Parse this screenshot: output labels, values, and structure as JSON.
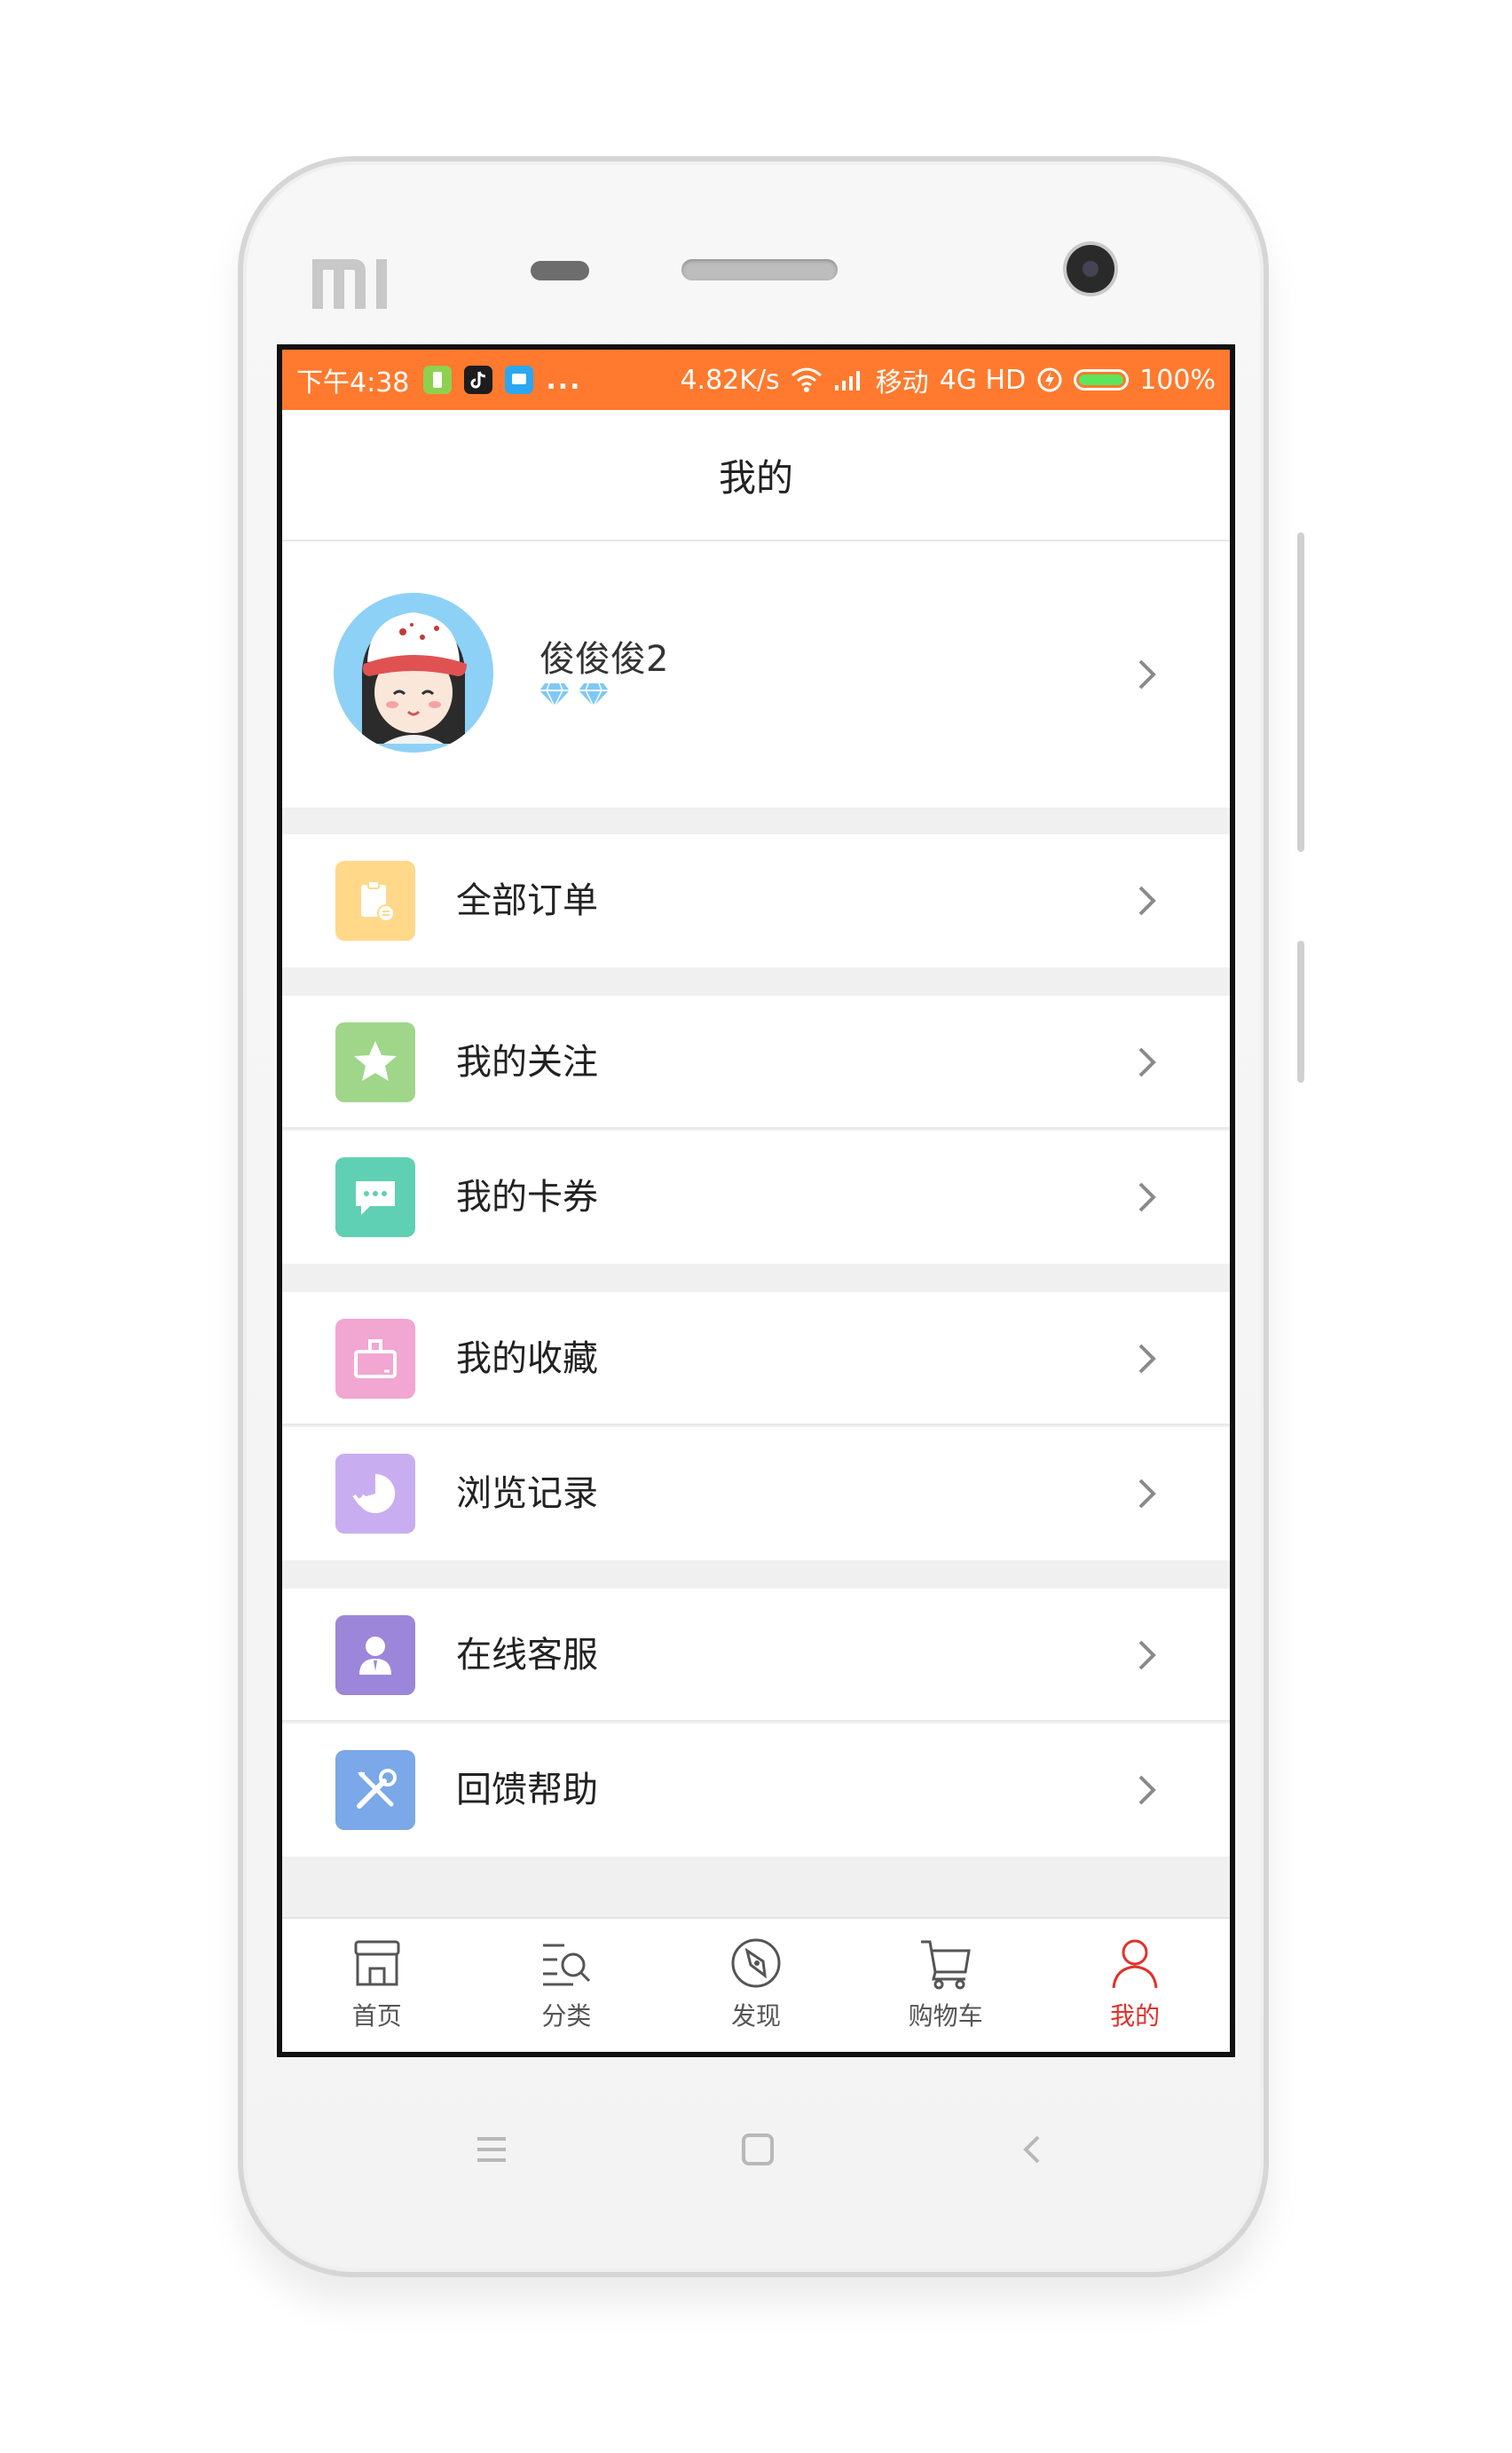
{
  "status_bar": {
    "time": "下午4:38",
    "dots": "...",
    "speed": "4.82K/s",
    "carrier": "移动",
    "network": "4G HD",
    "battery_text": "100%",
    "battery_level": 1.0,
    "icons": [
      "battery-app-icon",
      "tiktok-icon",
      "message-app-icon",
      "wifi-icon",
      "signal-icon",
      "charging-icon"
    ]
  },
  "header": {
    "title": "我的"
  },
  "profile": {
    "username": "俊俊俊2",
    "badge_icon": "diamond-icon",
    "badge_count": 2
  },
  "menu": [
    {
      "label": "全部订单",
      "icon": "clipboard-order-icon",
      "color": "#ffd88a"
    },
    {
      "label": "我的关注",
      "icon": "star-icon",
      "color": "#9fd68a"
    },
    {
      "label": "我的卡券",
      "icon": "chat-bubble-icon",
      "color": "#5fd0b3"
    },
    {
      "label": "我的收藏",
      "icon": "tv-collection-icon",
      "color": "#f2a6d2"
    },
    {
      "label": "浏览记录",
      "icon": "history-clock-icon",
      "color": "#c8aef0"
    },
    {
      "label": "在线客服",
      "icon": "service-person-icon",
      "color": "#9b86da"
    },
    {
      "label": "回馈帮助",
      "icon": "tools-icon",
      "color": "#7aa8e8"
    }
  ],
  "tabs": [
    {
      "label": "首页",
      "icon": "home-store-icon",
      "active": false
    },
    {
      "label": "分类",
      "icon": "category-search-icon",
      "active": false
    },
    {
      "label": "发现",
      "icon": "compass-icon",
      "active": false
    },
    {
      "label": "购物车",
      "icon": "cart-icon",
      "active": false
    },
    {
      "label": "我的",
      "icon": "user-icon",
      "active": true
    }
  ],
  "colors": {
    "status_bar": "#ff7a2e",
    "active_tab": "#e0322b"
  },
  "device": {
    "brand_logo": "mi-logo"
  }
}
